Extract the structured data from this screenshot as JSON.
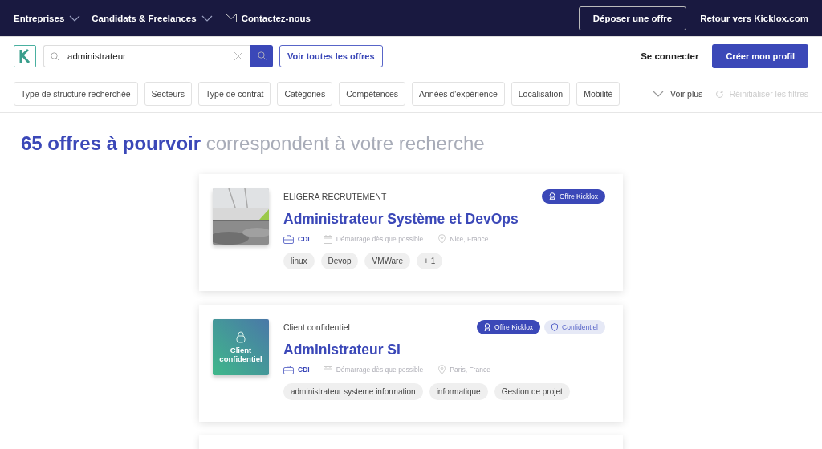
{
  "top_nav": {
    "menus": [
      {
        "label": "Entreprises",
        "kind": "dropdown"
      },
      {
        "label": "Candidats & Freelances",
        "kind": "dropdown"
      },
      {
        "label": "Contactez-nous",
        "kind": "mail"
      }
    ],
    "actions": [
      {
        "label": "Déposer une offre",
        "kind": "outline"
      },
      {
        "label": "Retour vers Kicklox.com",
        "kind": "link"
      }
    ]
  },
  "search": {
    "value": "administrateur",
    "all_offers_button": "Voir toutes les offres",
    "login": "Se connecter",
    "signup": "Créer mon profil"
  },
  "filters": {
    "items": [
      "Type de structure recherchée",
      "Secteurs",
      "Type de contrat",
      "Catégories",
      "Compétences",
      "Années d'expérience",
      "Localisation",
      "Mobilité"
    ],
    "more": "Voir plus",
    "reset": {
      "label": "Réinitialiser les filtres",
      "disabled": true
    }
  },
  "heading": "**65 offres à pourvoir** correspondent à votre recherche",
  "offers": [
    {
      "company": "ELIGERA RECRUTEMENT",
      "logo": {
        "kind": "picture"
      },
      "title": "Administrateur Système et DevOps",
      "badges": [
        {
          "label": "Offre Kicklox",
          "kind": "kicklox"
        }
      ],
      "contract": "CDI",
      "start": "Démarrage dès que possible",
      "location": "Nice, France",
      "tags": [
        "linux",
        "Devop",
        "VMWare",
        "+ 1"
      ]
    },
    {
      "company": "Client confidentiel",
      "logo": {
        "kind": "confidential",
        "label": "Client confidentiel"
      },
      "title": "Administrateur SI",
      "badges": [
        {
          "label": "Offre Kicklox",
          "kind": "kicklox"
        },
        {
          "label": "Confidentiel",
          "kind": "confidential"
        }
      ],
      "contract": "CDI",
      "start": "Démarrage dès que possible",
      "location": "Paris, France",
      "tags": [
        "administrateur systeme information",
        "informatique",
        "Gestion de projet"
      ]
    }
  ],
  "next_card_visible": true
}
